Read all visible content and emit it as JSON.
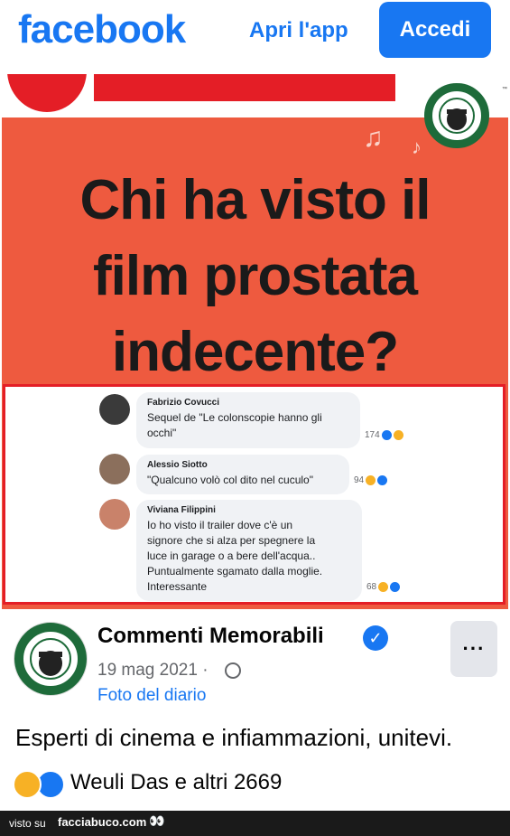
{
  "header": {
    "logo": "facebook",
    "open_app": "Apri l'app",
    "login": "Accedi"
  },
  "meme": {
    "title_lines": [
      "Chi ha visto il",
      "film prostata",
      "indecente?"
    ],
    "comments": [
      {
        "name": "Fabrizio Covucci",
        "lines": [
          "Sequel de \"Le colonscopie hanno gli",
          "occhi\""
        ],
        "count": "174"
      },
      {
        "name": "Alessio Siotto",
        "lines": [
          "\"Qualcuno volò col dito nel cuculo\""
        ],
        "count": "94"
      },
      {
        "name": "Viviana Filippini",
        "lines": [
          "Io ho visto il trailer dove c'è un",
          "signore che si alza per spegnere la",
          "luce in garage o a bere dell'acqua..",
          "Puntualmente sgamato dalla moglie.",
          "Interessante"
        ],
        "count": "68"
      }
    ]
  },
  "post": {
    "page_name": "Commenti Memorabili",
    "date": "19 mag 2021 ·",
    "diary_link": "Foto del diario",
    "text": "Esperti di cinema e infiammazioni, unitevi.",
    "reactions_text": "Weuli Das e altri 2669"
  },
  "footer": {
    "visto": "visto su",
    "site": "facciabuco.com"
  },
  "colors": {
    "brand_blue": "#1877f2",
    "meme_bg": "#ee5a3f",
    "meme_red": "#e41e26"
  },
  "icons": [
    "verified-icon",
    "globe-icon",
    "more-icon",
    "haha-reaction-icon",
    "like-reaction-icon",
    "music-note-icon"
  ]
}
